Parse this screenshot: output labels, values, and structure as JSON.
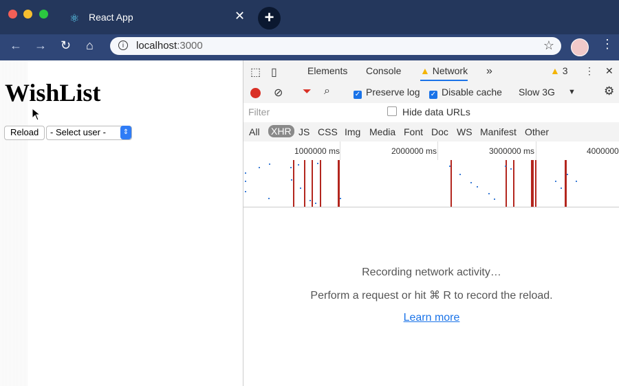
{
  "browser": {
    "tab_title": "React App",
    "tab_close": "✕",
    "new_tab": "+",
    "url_host": "localhost",
    "url_port": ":3000",
    "traffic_colors": [
      "#f25f57",
      "#f6be2f",
      "#2bc840"
    ]
  },
  "page": {
    "title": "WishList",
    "reload_button": "Reload",
    "select_user": "- Select user -"
  },
  "devtools": {
    "tabs": [
      "Elements",
      "Console",
      "Network"
    ],
    "warning_count": "3",
    "more_tabs": "»",
    "preserve_log": "Preserve log",
    "disable_cache": "Disable cache",
    "throttle": "Slow 3G",
    "filter_placeholder": "Filter",
    "hide_data_urls": "Hide data URLs",
    "types": [
      "All",
      "XHR",
      "JS",
      "CSS",
      "Img",
      "Media",
      "Font",
      "Doc",
      "WS",
      "Manifest",
      "Other"
    ],
    "ruler_ticks": [
      "1000000 ms",
      "2000000 ms",
      "3000000 ms",
      "4000000"
    ],
    "empty_title": "Recording network activity…",
    "empty_body": "Perform a request or hit ⌘ R to record the reload.",
    "learn_more": "Learn more"
  }
}
